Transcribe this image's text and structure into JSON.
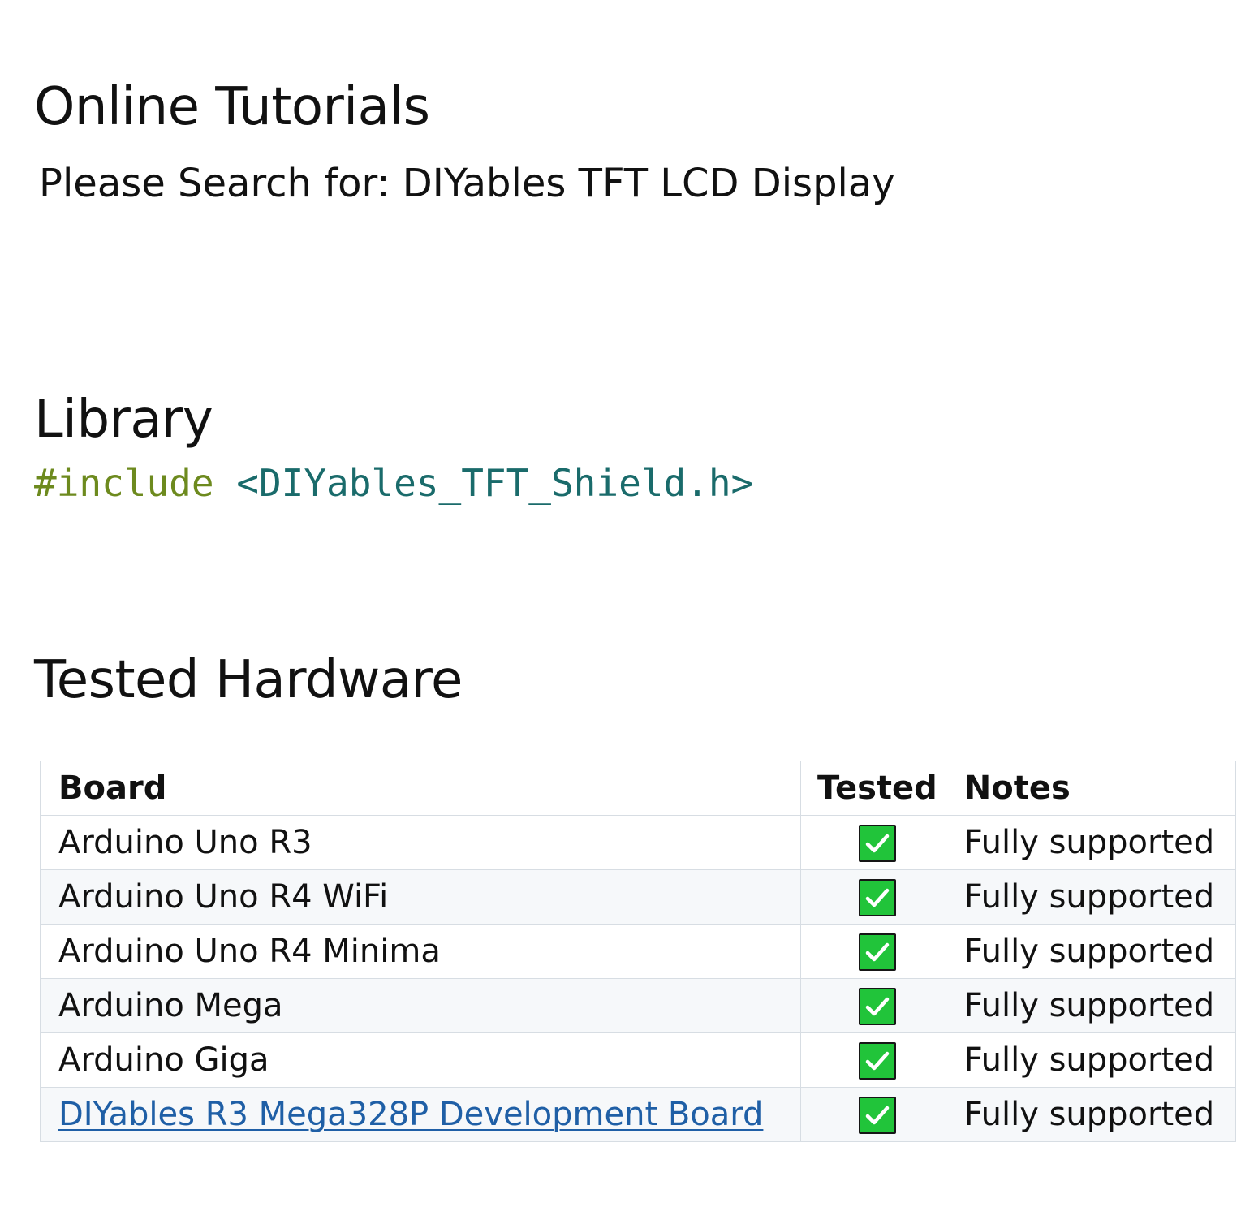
{
  "sections": {
    "tutorials": {
      "title": "Online Tutorials",
      "search_text": "Please Search for: DIYables TFT LCD Display"
    },
    "library": {
      "title": "Library",
      "code_directive": "#include",
      "code_header": "<DIYables_TFT_Shield.h>"
    },
    "hardware": {
      "title": "Tested Hardware",
      "columns": [
        "Board",
        "Tested",
        "Notes"
      ],
      "rows": [
        {
          "board": "Arduino Uno R3",
          "tested": "check-icon",
          "notes": "Fully supported",
          "is_link": false
        },
        {
          "board": "Arduino Uno R4 WiFi",
          "tested": "check-icon",
          "notes": "Fully supported",
          "is_link": false
        },
        {
          "board": "Arduino Uno R4 Minima",
          "tested": "check-icon",
          "notes": "Fully supported",
          "is_link": false
        },
        {
          "board": "Arduino Mega",
          "tested": "check-icon",
          "notes": "Fully supported",
          "is_link": false
        },
        {
          "board": "Arduino Giga",
          "tested": "check-icon",
          "notes": "Fully supported",
          "is_link": false
        },
        {
          "board": "DIYables R3 Mega328P Development Board",
          "tested": "check-icon",
          "notes": "Fully supported",
          "is_link": true
        }
      ]
    }
  },
  "colors": {
    "text": "#111111",
    "code_directive": "#6d8a1e",
    "code_header": "#1a6b6b",
    "link": "#1f5fa6",
    "check_fill": "#21c43a",
    "table_border": "#d7dde3",
    "row_alt": "#f6f8fa"
  }
}
